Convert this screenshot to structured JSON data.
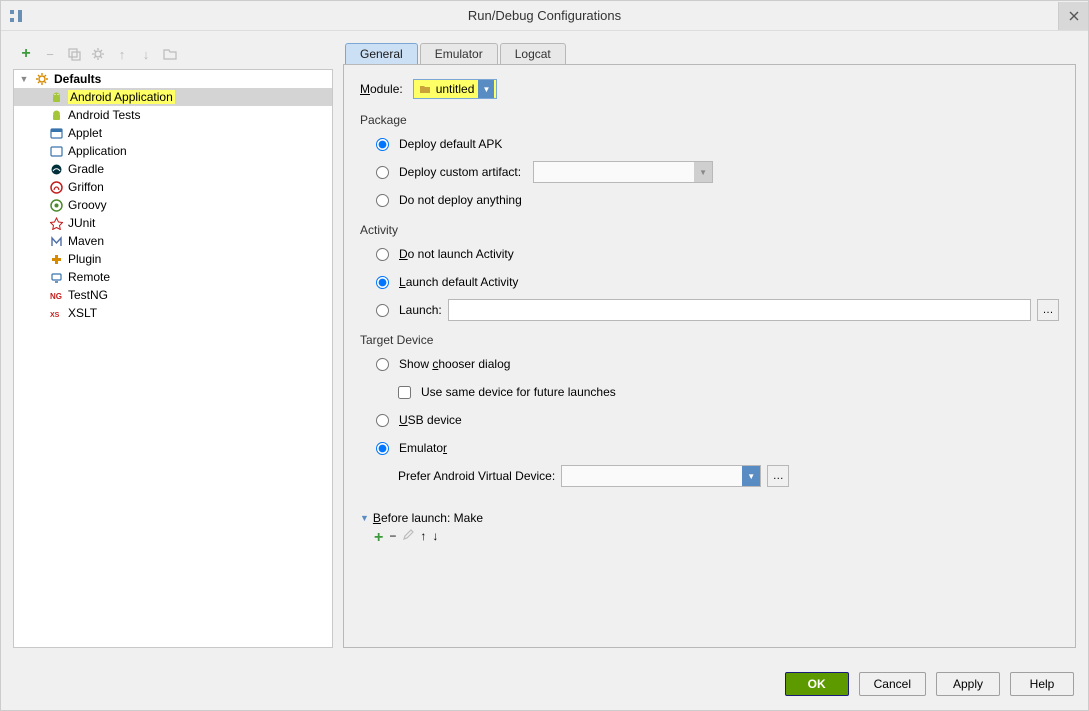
{
  "window": {
    "title": "Run/Debug Configurations"
  },
  "toolbar": {
    "add": "+",
    "remove": "−",
    "copy_icon": "copy",
    "settings_icon": "settings",
    "up": "↑",
    "down": "↓",
    "folder_icon": "folder"
  },
  "tree": {
    "root_label": "Defaults",
    "items": [
      {
        "label": "Android Application",
        "icon": "android",
        "color": "#a4c639",
        "selected": true,
        "highlight": true
      },
      {
        "label": "Android Tests",
        "icon": "android",
        "color": "#a4c639"
      },
      {
        "label": "Applet",
        "icon": "applet",
        "color": "#3973ac"
      },
      {
        "label": "Application",
        "icon": "app",
        "color": "#3973ac"
      },
      {
        "label": "Gradle",
        "icon": "gradle",
        "color": "#02303a"
      },
      {
        "label": "Griffon",
        "icon": "griffon",
        "color": "#c51d1d"
      },
      {
        "label": "Groovy",
        "icon": "groovy",
        "color": "#4c8a2b"
      },
      {
        "label": "JUnit",
        "icon": "junit",
        "color": "#c51d1d"
      },
      {
        "label": "Maven",
        "icon": "maven",
        "color": "#4c6ea9"
      },
      {
        "label": "Plugin",
        "icon": "plugin",
        "color": "#d78a00"
      },
      {
        "label": "Remote",
        "icon": "remote",
        "color": "#3973ac"
      },
      {
        "label": "TestNG",
        "icon": "testng",
        "color": "#c51d1d"
      },
      {
        "label": "XSLT",
        "icon": "xslt",
        "color": "#c51d1d"
      }
    ]
  },
  "tabs": [
    {
      "label": "General",
      "active": true
    },
    {
      "label": "Emulator",
      "active": false
    },
    {
      "label": "Logcat",
      "active": false
    }
  ],
  "form": {
    "module_label": "Module:",
    "module_value": "untitled",
    "package": {
      "section": "Package",
      "deploy_default": "Deploy default APK",
      "deploy_custom": "Deploy custom artifact:",
      "do_not_deploy": "Do not deploy anything",
      "selected": "deploy_default",
      "custom_value": ""
    },
    "activity": {
      "section": "Activity",
      "do_not_launch": "Do not launch Activity",
      "launch_default": "Launch default Activity",
      "launch": "Launch:",
      "selected": "launch_default",
      "launch_value": ""
    },
    "target": {
      "section": "Target Device",
      "show_chooser": "Show chooser dialog",
      "use_same_device": "Use same device for future launches",
      "usb_device": "USB device",
      "emulator": "Emulator",
      "prefer_label": "Prefer Android Virtual Device:",
      "selected": "emulator",
      "prefer_value": ""
    },
    "before_launch": {
      "label": "Before launch: Make"
    }
  },
  "buttons": {
    "ok": "OK",
    "cancel": "Cancel",
    "apply": "Apply",
    "help": "Help"
  }
}
